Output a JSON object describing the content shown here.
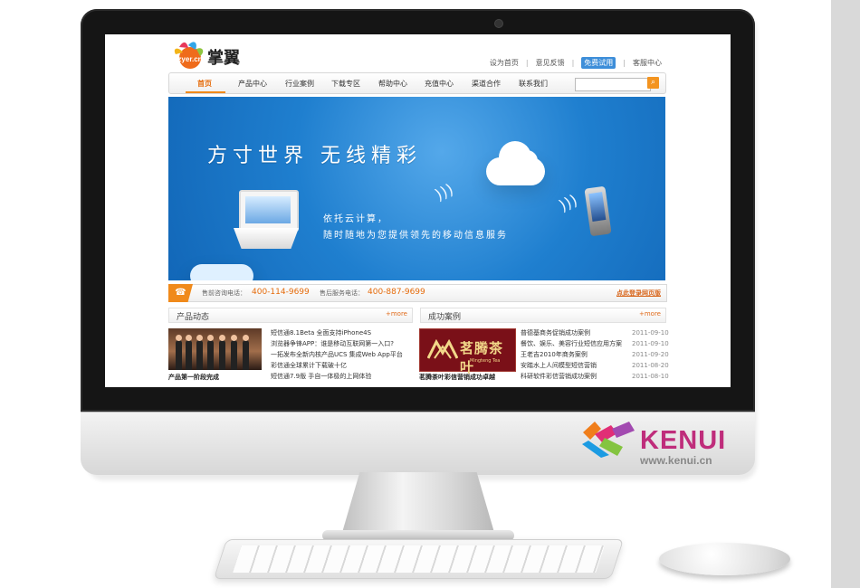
{
  "brand": {
    "name": "KENUI",
    "url": "www.kenui.cn"
  },
  "site": {
    "logo_text": "掌翼",
    "logo_badge": "zyer.cn",
    "top_links": [
      "设为首页",
      "意见反馈",
      "免费试用",
      "客服中心"
    ],
    "nav": [
      "首页",
      "产品中心",
      "行业案例",
      "下载专区",
      "帮助中心",
      "充值中心",
      "渠道合作",
      "联系我们"
    ],
    "search_placeholder": ""
  },
  "banner": {
    "title": "方寸世界  无线精彩",
    "subtitle1": "依托云计算，",
    "subtitle2": "随时随地为您提供领先的移动信息服务"
  },
  "hotline": {
    "presale_label": "售前咨询电话：",
    "presale_number": "400-114-9699",
    "aftersale_label": "售后服务电话：",
    "aftersale_number": "400-887-9699",
    "login_link": "点此登录网页版"
  },
  "news": {
    "title": "产品动态",
    "more": "more",
    "caption": "产品第一阶段完成",
    "items": [
      "短信通8.1Beta 全面支持iPhone4S",
      "浏览器争锋APP：谁是移动互联网第一入口?",
      "一拓发布全新内核产品UCS 集成Web App平台",
      "彩信通全球累计下载破十亿",
      "短信通7.9版 手自一体极的上网体验"
    ]
  },
  "cases": {
    "title": "成功案例",
    "more": "more",
    "caption": "茗腾茶叶彩信营销成功卓越",
    "logo_text": "茗腾茶叶",
    "logo_sub": "Mingteng Tea",
    "items": [
      "普德基商务促销成功案例",
      "餐饮、娱乐、美容行业短信应用方案",
      "王老吉2010年商务案例",
      "安踏水上人间模型短信营销",
      "科研软件彩信营销成功案例"
    ],
    "dates": [
      "2011-09-10",
      "2011-09-10",
      "2011-09-20",
      "2011-08-20",
      "2011-08-10"
    ]
  }
}
